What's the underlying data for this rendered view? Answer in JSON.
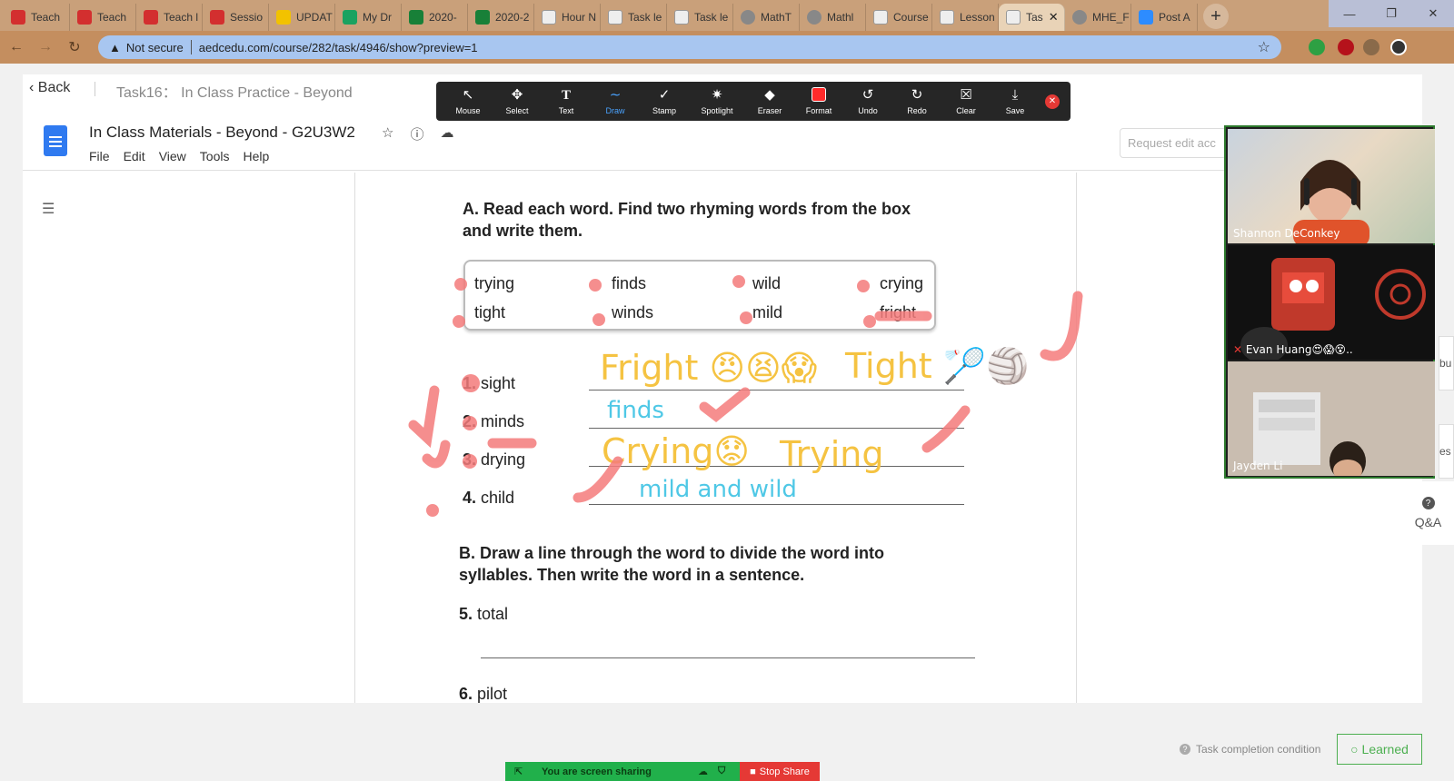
{
  "browser": {
    "tabs": [
      {
        "label": "Teach",
        "color": "#d32f2f"
      },
      {
        "label": "Teach",
        "color": "#d32f2f"
      },
      {
        "label": "Teach l",
        "color": "#d32f2f"
      },
      {
        "label": "Sessio",
        "color": "#d32f2f"
      },
      {
        "label": "UPDAT",
        "color": "#f2c200"
      },
      {
        "label": "My Dr",
        "color": "#1aa260"
      },
      {
        "label": "2020-",
        "color": "#188038"
      },
      {
        "label": "2020-2",
        "color": "#188038"
      },
      {
        "label": "Hour N",
        "color": "#e8e8e8"
      },
      {
        "label": "Task le",
        "color": "#e8e8e8"
      },
      {
        "label": "Task le",
        "color": "#e8e8e8"
      },
      {
        "label": "MathT",
        "color": "#888888"
      },
      {
        "label": "Mathl",
        "color": "#888888"
      },
      {
        "label": "Course",
        "color": "#e8e8e8"
      },
      {
        "label": "Lesson",
        "color": "#e8e8e8"
      },
      {
        "label": "Tas",
        "color": "#e8e8e8",
        "active": true
      },
      {
        "label": "MHE_F",
        "color": "#888888"
      },
      {
        "label": "Post A",
        "color": "#2d8cff"
      }
    ],
    "address": {
      "security": "Not secure",
      "url": "aedcedu.com/course/282/task/4946/show?preview=1"
    }
  },
  "page": {
    "back_label": "Back",
    "task_title": "Task16： In Class Practice - Beyond",
    "request_edit": "Request edit acc"
  },
  "annotate_toolbar": {
    "tools": [
      {
        "label": "Mouse",
        "icon": "↖"
      },
      {
        "label": "Select",
        "icon": "✥"
      },
      {
        "label": "Text",
        "icon": "T"
      },
      {
        "label": "Draw",
        "icon": "∼"
      },
      {
        "label": "Stamp",
        "icon": "✓"
      },
      {
        "label": "Spotlight",
        "icon": "✷"
      },
      {
        "label": "Eraser",
        "icon": "◆"
      },
      {
        "label": "Format",
        "icon": ""
      },
      {
        "label": "Undo",
        "icon": "↺"
      },
      {
        "label": "Redo",
        "icon": "↻"
      },
      {
        "label": "Clear",
        "icon": "☒"
      },
      {
        "label": "Save",
        "icon": "⤓"
      }
    ]
  },
  "gdoc": {
    "title": "In Class Materials - Beyond - G2U3W2",
    "menu": [
      "File",
      "Edit",
      "View",
      "Tools",
      "Help"
    ]
  },
  "worksheet": {
    "partA_heading_1": "A. Read each word. Find two rhyming words from the box",
    "partA_heading_2": "and write them.",
    "box_words": [
      "trying",
      "finds",
      "wild",
      "crying",
      "tight",
      "winds",
      "mild",
      "fright"
    ],
    "questions": [
      {
        "num": "1.",
        "word": "sight"
      },
      {
        "num": "2.",
        "word": "minds"
      },
      {
        "num": "3.",
        "word": "drying"
      },
      {
        "num": "4.",
        "word": "child"
      }
    ],
    "answers": {
      "a1_left": "Fright 😠😫😱",
      "a1_right": "Tight 🏸🏐",
      "a2": "finds",
      "a3_left": "Crying😟",
      "a3_right": "Trying",
      "a4": "mild and wild"
    },
    "partB_heading_1": "B. Draw a line through the word to divide the word into",
    "partB_heading_2": "syllables. Then write the word in a sentence.",
    "q5": {
      "num": "5.",
      "word": "total"
    },
    "q6": {
      "num": "6.",
      "word": "pilot"
    }
  },
  "video": {
    "participants": [
      "Shannon DeConkey",
      "Evan Huang😍😱😵..",
      "Jayden Li"
    ]
  },
  "sidebar": {
    "qa_label": "Q&A",
    "partial_1": "bu",
    "partial_2": "es"
  },
  "footer": {
    "task_condition": "Task completion condition",
    "learned": "Learned",
    "sharing": "You are screen sharing",
    "stop_share": "Stop Share"
  }
}
